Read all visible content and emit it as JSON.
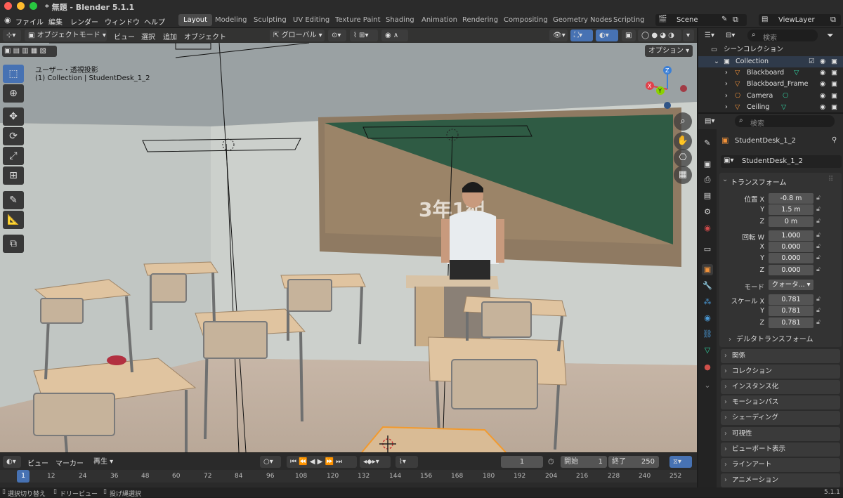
{
  "window": {
    "title": "* 無題 - Blender 5.1.1"
  },
  "menu": [
    "ファイル",
    "編集",
    "レンダー",
    "ウィンドウ",
    "ヘルプ"
  ],
  "workspaces": [
    "Layout",
    "Modeling",
    "Sculpting",
    "UV Editing",
    "Texture Paint",
    "Shading",
    "Animation",
    "Rendering",
    "Compositing",
    "Geometry Nodes",
    "Scripting"
  ],
  "scene": {
    "name": "Scene",
    "view_layer": "ViewLayer"
  },
  "viewport_header": {
    "mode": "オブジェクトモード",
    "menus": [
      "ビュー",
      "選択",
      "追加",
      "オブジェクト"
    ],
    "orientation": "グローバル",
    "options": "オプション"
  },
  "viewport": {
    "view_name": "ユーザー・透視投影",
    "collection_info": "(1) Collection | StudentDesk_1_2",
    "blackboard_text": "3年1組"
  },
  "outliner": {
    "search_placeholder": "検索",
    "root": "シーンコレクション",
    "collection": "Collection",
    "items": [
      "Blackboard",
      "Blackboard_Frame",
      "Camera",
      "Ceiling"
    ]
  },
  "properties": {
    "search_placeholder": "検索",
    "object_name": "StudentDesk_1_2",
    "data_name": "StudentDesk_1_2",
    "transform_title": "トランスフォーム",
    "location_label": "位置",
    "rotation_label": "回転",
    "mode_label": "モード",
    "scale_label": "スケール",
    "axes": {
      "x": "X",
      "y": "Y",
      "z": "Z",
      "w": "W"
    },
    "location": [
      "-0.8 m",
      "1.5 m",
      "0 m"
    ],
    "rotation": [
      "1.000",
      "0.000",
      "0.000",
      "0.000"
    ],
    "rotation_mode": "クォータ...",
    "scale": [
      "0.781",
      "0.781",
      "0.781"
    ],
    "delta_transform": "デルタトランスフォーム",
    "panels": [
      "関係",
      "コレクション",
      "インスタンス化",
      "モーションパス",
      "シェーディング",
      "可視性",
      "ビューポート表示",
      "ラインアート",
      "アニメーション"
    ]
  },
  "timeline": {
    "menus": [
      "ビュー",
      "マーカー"
    ],
    "playback": "再生",
    "current_frame": "1",
    "start_label": "開始",
    "start": "1",
    "end_label": "終了",
    "end": "250",
    "ticks": [
      "1",
      "12",
      "24",
      "36",
      "48",
      "60",
      "72",
      "84",
      "96",
      "108",
      "120",
      "132",
      "144",
      "156",
      "168",
      "180",
      "192",
      "204",
      "216",
      "228",
      "240",
      "252"
    ]
  },
  "statusbar": {
    "items": [
      "選択切り替え",
      "ドリービュー",
      "投げ縄選択"
    ],
    "version": "5.1.1"
  },
  "colors": {
    "accent": "#4772b3",
    "active_tab": "#4a4a4a",
    "x_axis": "#e0404a",
    "y_axis": "#8bd200",
    "z_axis": "#3b7fd6"
  }
}
